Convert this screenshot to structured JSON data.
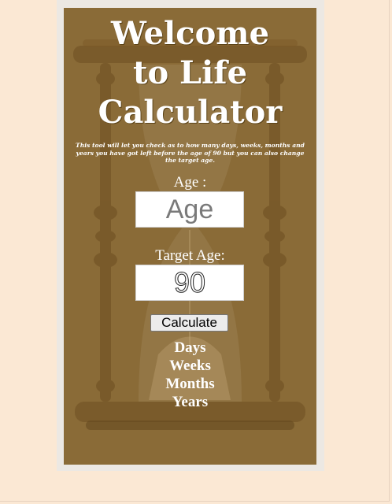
{
  "title_line1": "Welcome",
  "title_line2": "to Life",
  "title_line3": "Calculator",
  "intro": "This tool will let you check as to how many days, weeks, months and years you have got left before the age of 90 but you can also change the target age.",
  "age_label": "Age :",
  "age_input": {
    "placeholder": "Age",
    "value": ""
  },
  "target_label": "Target Age:",
  "target_input": {
    "value": "90"
  },
  "calculate_label": "Calculate",
  "results": [
    "Days",
    "Weeks",
    "Months",
    "Years"
  ],
  "colors": {
    "page_background": "#fbe8d4",
    "card_background": "#8a6b37",
    "text": "#ffffff"
  }
}
